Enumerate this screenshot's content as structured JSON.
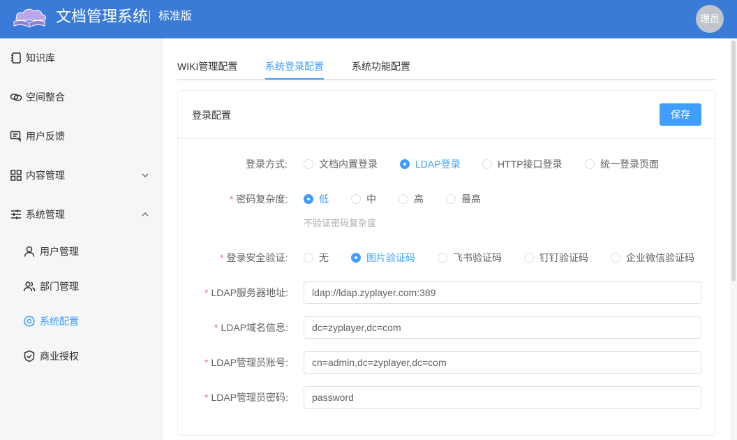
{
  "header": {
    "app_title": "文档管理系统",
    "edition": "标准版",
    "avatar_text": "理员"
  },
  "sidebar": {
    "items": [
      {
        "label": "知识库",
        "icon": "notebook-icon"
      },
      {
        "label": "空间整合",
        "icon": "link-icon"
      },
      {
        "label": "用户反馈",
        "icon": "feedback-icon"
      },
      {
        "label": "内容管理",
        "icon": "grid-icon",
        "chevron": "chevron-down-icon"
      },
      {
        "label": "系统管理",
        "icon": "sliders-icon",
        "chevron": "chevron-up-icon"
      }
    ],
    "sub_items": [
      {
        "label": "用户管理",
        "icon": "user-icon"
      },
      {
        "label": "部门管理",
        "icon": "users-icon"
      },
      {
        "label": "系统配置",
        "icon": "gear-icon",
        "active": true
      },
      {
        "label": "商业授权",
        "icon": "shield-check-icon"
      }
    ]
  },
  "tabs": [
    {
      "label": "WIKI管理配置"
    },
    {
      "label": "系统登录配置",
      "active": true
    },
    {
      "label": "系统功能配置"
    }
  ],
  "card": {
    "title": "登录配置",
    "save_label": "保存"
  },
  "form": {
    "login_method": {
      "label": "登录方式:",
      "options": [
        "文档内置登录",
        "LDAP登录",
        "HTTP接口登录",
        "统一登录页面"
      ],
      "selected": "LDAP登录"
    },
    "password_complexity": {
      "label": "密码复杂度:",
      "options": [
        "低",
        "中",
        "高",
        "最高"
      ],
      "selected": "低",
      "hint": "不验证密码复杂度"
    },
    "login_security": {
      "label": "登录安全验证:",
      "options": [
        "无",
        "图片验证码",
        "飞书验证码",
        "钉钉验证码",
        "企业微信验证码"
      ],
      "selected": "图片验证码"
    },
    "ldap_server": {
      "label": "LDAP服务器地址:",
      "value": "ldap://ldap.zyplayer.com:389"
    },
    "ldap_domain": {
      "label": "LDAP域名信息:",
      "value": "dc=zyplayer,dc=com"
    },
    "ldap_admin": {
      "label": "LDAP管理员账号:",
      "value": "cn=admin,dc=zyplayer,dc=com"
    },
    "ldap_password": {
      "label": "LDAP管理员密码:",
      "value": "password"
    }
  },
  "colors": {
    "header_bg": "#3a7bd8",
    "accent": "#409eff",
    "required": "#f56c6c"
  }
}
